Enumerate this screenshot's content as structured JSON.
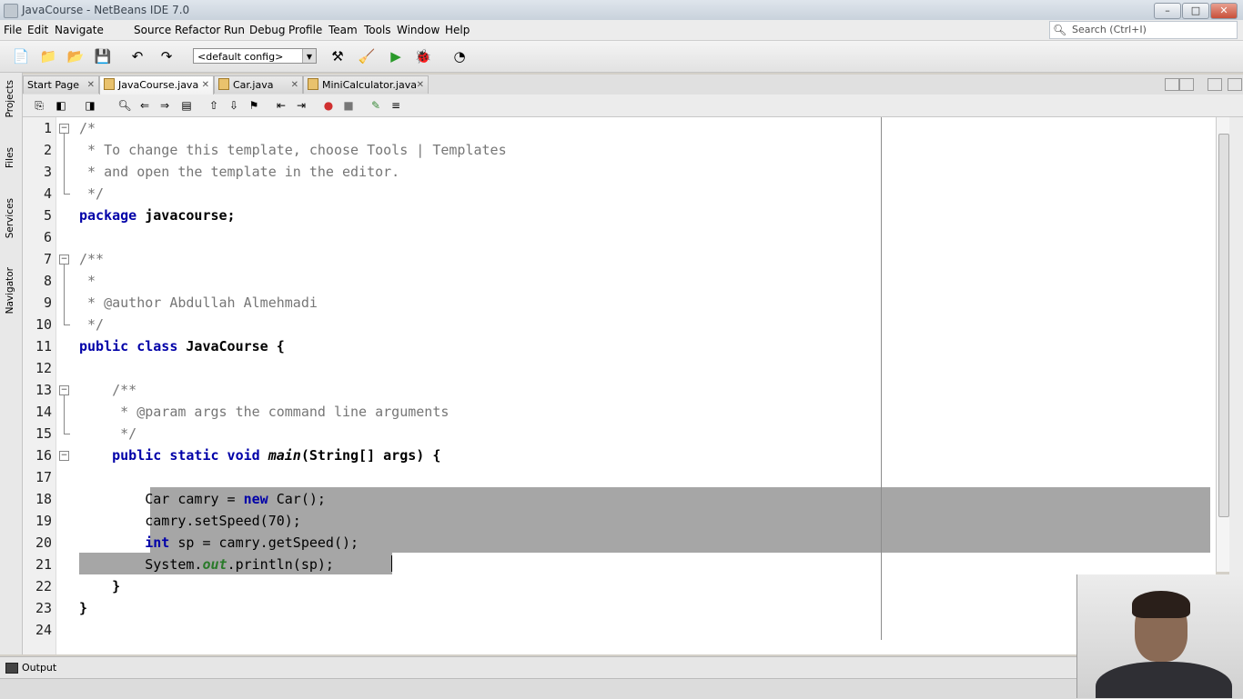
{
  "window": {
    "title": "JavaCourse - NetBeans IDE 7.0",
    "controls": [
      "–",
      "□",
      "✕"
    ]
  },
  "menu": [
    "File",
    "Edit",
    "Navigate",
    "Source",
    "Refactor",
    "Run",
    "Debug",
    "Profile",
    "Team",
    "Tools",
    "Window",
    "Help"
  ],
  "search": {
    "placeholder": "Search (Ctrl+I)"
  },
  "toolbar": {
    "config": "<default config>"
  },
  "sidebar": [
    "Projects",
    "Files",
    "Services",
    "Navigator"
  ],
  "tabs": [
    {
      "label": "Start Page",
      "active": false
    },
    {
      "label": "JavaCourse.java",
      "active": true
    },
    {
      "label": "Car.java",
      "active": false
    },
    {
      "label": "MiniCalculator.java",
      "active": false
    }
  ],
  "editor": {
    "line_numbers": [
      "1",
      "2",
      "3",
      "4",
      "5",
      "6",
      "7",
      "8",
      "9",
      "10",
      "11",
      "12",
      "13",
      "14",
      "15",
      "16",
      "17",
      "18",
      "19",
      "20",
      "21",
      "22",
      "23",
      "24"
    ]
  },
  "output": {
    "label": "Output"
  },
  "colors": {
    "keyword": "#0000a8",
    "comment": "#767676",
    "selection": "#a6a6a6"
  }
}
